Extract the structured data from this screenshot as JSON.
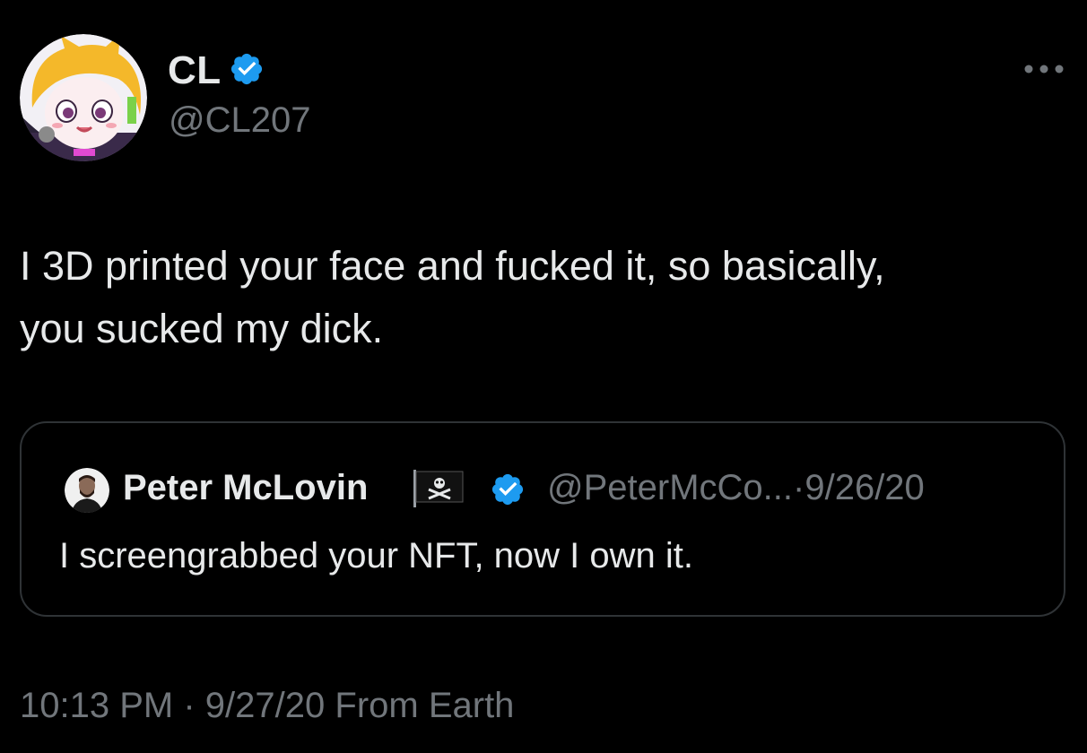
{
  "tweet": {
    "author": {
      "name": "CL",
      "handle": "@CL207",
      "verified": true,
      "avatar_icon": "anime-cat-avatar"
    },
    "text_line1": "I 3D printed your face and fucked it, so basically,",
    "text_line2": "you sucked my dick.",
    "more_icon": "more-horizontal-icon",
    "quoted": {
      "author_name": "Peter McLovin",
      "flag_emoji": "🏴‍☠️",
      "verified": true,
      "handle": "@PeterMcCo...",
      "separator": "·",
      "date": "9/26/20",
      "text": "I screengrabbed your NFT, now I own it."
    },
    "meta": {
      "time": "10:13 PM",
      "separator": "·",
      "date": "9/27/20",
      "source": "From Earth"
    }
  },
  "colors": {
    "background": "#000000",
    "text_primary": "#e7e9ea",
    "text_secondary": "#71767b",
    "border": "#2f3336",
    "verified_blue": "#1d9bf0"
  }
}
